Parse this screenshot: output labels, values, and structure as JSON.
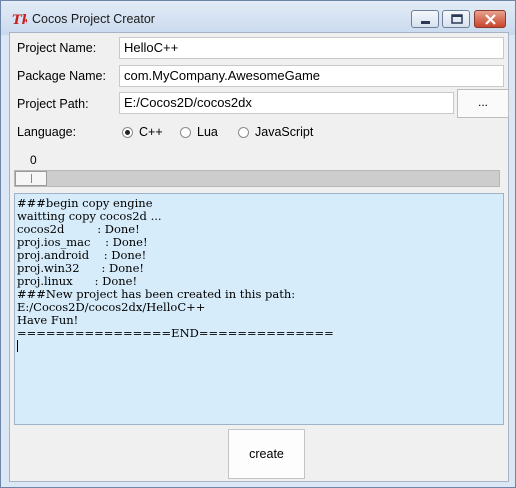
{
  "window": {
    "title": "Cocos Project Creator",
    "icon": "tk-feather-icon",
    "controls": {
      "minimize": "minimize-icon",
      "maximize": "maximize-icon",
      "close": "close-icon"
    }
  },
  "form": {
    "project_name": {
      "label": "Project Name:",
      "value": "HelloC++"
    },
    "package_name": {
      "label": "Package Name:",
      "value": "com.MyCompany.AwesomeGame"
    },
    "project_path": {
      "label": "Project Path:",
      "value": "E:/Cocos2D/cocos2dx",
      "browse_label": "..."
    },
    "language": {
      "label": "Language:",
      "options": [
        "C++",
        "Lua",
        "JavaScript"
      ],
      "selected": "C++"
    }
  },
  "progress": {
    "scale_label": "0",
    "value": 0
  },
  "console": {
    "lines": [
      "###begin copy engine",
      "waitting copy cocos2d ...",
      "cocos2d         : Done!",
      "proj.ios_mac    : Done!",
      "proj.android    : Done!",
      "proj.win32      : Done!",
      "proj.linux      : Done!",
      "###New project has been created in this path:",
      "E:/Cocos2D/cocos2dx/HelloC++",
      "Have Fun!",
      "================END=============="
    ]
  },
  "actions": {
    "create_label": "create"
  },
  "colors": {
    "title_bar": "#d3e0f1",
    "close_button": "#c8452c",
    "console_bg": "#d6ecfa",
    "client_bg": "#f0f0f0"
  }
}
